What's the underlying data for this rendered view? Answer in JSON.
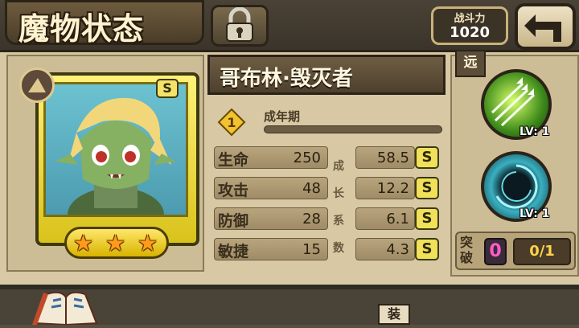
{
  "header": {
    "title": "魔物状态",
    "power_label": "战斗力",
    "power_value": "1020"
  },
  "monster": {
    "name": "哥布林·毁灭者",
    "grade": "S",
    "star_count": 3,
    "stage_level": "1",
    "stage_label": "成年期"
  },
  "stats": [
    {
      "name": "生命",
      "value": "250",
      "growth": "58.5",
      "grade": "S",
      "growth_char": "成"
    },
    {
      "name": "攻击",
      "value": "48",
      "growth": "12.2",
      "grade": "S",
      "growth_char": "长"
    },
    {
      "name": "防御",
      "value": "28",
      "growth": "6.1",
      "grade": "S",
      "growth_char": "系"
    },
    {
      "name": "敏捷",
      "value": "15",
      "growth": "4.3",
      "grade": "S",
      "growth_char": "数"
    }
  ],
  "side": {
    "range_tag": "远",
    "skills": [
      {
        "icon": "arrow-volley-skill-icon",
        "level": "LV: 1"
      },
      {
        "icon": "dark-vortex-skill-icon",
        "level": "LV: 1"
      }
    ],
    "breakthrough_label": "突破",
    "breakthrough_count": "0",
    "breakthrough_progress": "0/1"
  },
  "bottom": {
    "tab_label": "装"
  },
  "colors": {
    "accent_gold": "#f0e05a",
    "panel_bg": "#d8c9a4",
    "pink": "#ff5cc8"
  }
}
